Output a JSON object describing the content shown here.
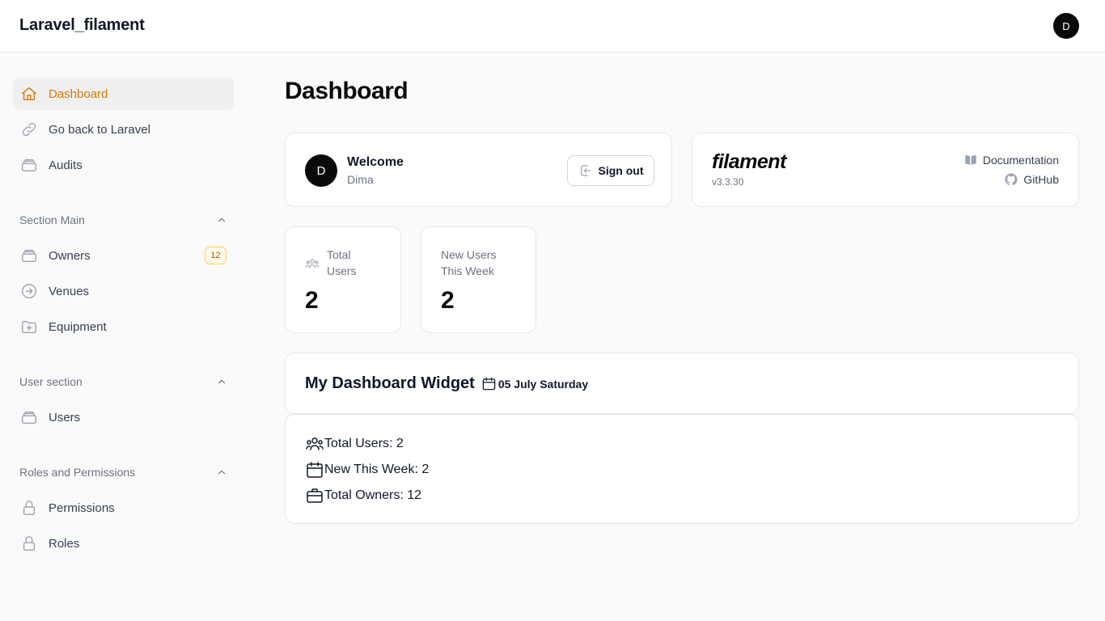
{
  "app": {
    "brand": "Laravel_filament",
    "user_initial": "D"
  },
  "sidebar": {
    "items": [
      {
        "label": "Dashboard",
        "icon": "home-icon",
        "active": true
      },
      {
        "label": "Go back to Laravel",
        "icon": "link-icon"
      },
      {
        "label": "Audits",
        "icon": "stack-icon"
      }
    ],
    "groups": [
      {
        "label": "Section Main",
        "items": [
          {
            "label": "Owners",
            "icon": "stack-icon",
            "badge": "12"
          },
          {
            "label": "Venues",
            "icon": "arrow-circle-icon"
          },
          {
            "label": "Equipment",
            "icon": "folder-plus-icon"
          }
        ]
      },
      {
        "label": "User section",
        "items": [
          {
            "label": "Users",
            "icon": "stack-icon"
          }
        ]
      },
      {
        "label": "Roles and Permissions",
        "items": [
          {
            "label": "Permissions",
            "icon": "lock-icon"
          },
          {
            "label": "Roles",
            "icon": "lock-icon"
          }
        ]
      }
    ]
  },
  "page": {
    "title": "Dashboard"
  },
  "welcome": {
    "title": "Welcome",
    "name": "Dima",
    "initial": "D",
    "sign_out": "Sign out"
  },
  "filament": {
    "logo": "filament",
    "version": "v3.3.30",
    "docs": "Documentation",
    "github": "GitHub"
  },
  "stats": [
    {
      "label": "Total Users",
      "value": "2",
      "icon": "user-group-icon"
    },
    {
      "label": "New Users This Week",
      "value": "2"
    }
  ],
  "widget": {
    "title": "My Dashboard Widget",
    "date": "05 July Saturday",
    "lines": [
      {
        "icon": "user-group-icon",
        "text": "Total Users: 2"
      },
      {
        "icon": "calendar-icon",
        "text": "New This Week: 2"
      },
      {
        "icon": "briefcase-icon",
        "text": "Total Owners: 12"
      }
    ]
  },
  "colors": {
    "accent": "#d97706",
    "badge_bg": "#fffbeb",
    "badge_border": "#fcd34d",
    "text_muted": "#6b7280"
  }
}
